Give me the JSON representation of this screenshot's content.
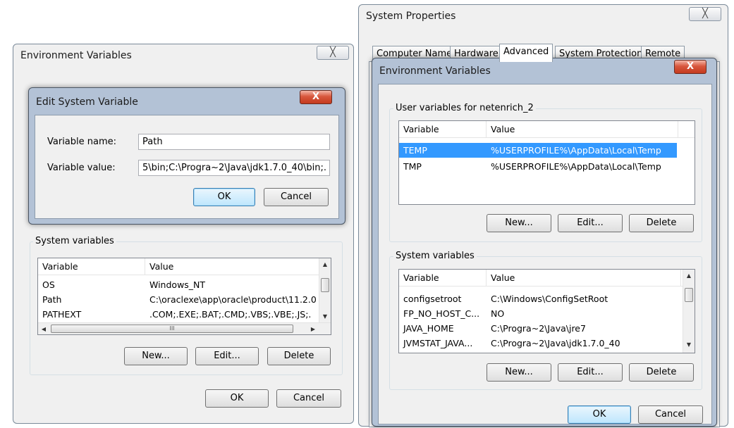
{
  "left_window": {
    "title": "Environment Variables",
    "close_label": "╳",
    "system_group_title": "System variables",
    "columns": [
      "Variable",
      "Value"
    ],
    "system_rows": [
      {
        "variable": "OS",
        "value": "Windows_NT"
      },
      {
        "variable": "Path",
        "value": "C:\\oraclexe\\app\\oracle\\product\\11.2.0"
      },
      {
        "variable": "PATHEXT",
        "value": ".COM;.EXE;.BAT;.CMD;.VBS;.VBE;.JS;."
      }
    ],
    "hscroll_grip": "III",
    "buttons": {
      "new": "New...",
      "edit": "Edit...",
      "delete": "Delete",
      "ok": "OK",
      "cancel": "Cancel"
    }
  },
  "edit_dialog": {
    "title": "Edit System Variable",
    "close_label": "X",
    "name_label": "Variable name:",
    "name_value": "Path",
    "value_label": "Variable value:",
    "value_value": "5\\bin;C:\\Progra~2\\Java\\jdk1.7.0_40\\bin;.",
    "ok": "OK",
    "cancel": "Cancel"
  },
  "system_properties": {
    "title": "System Properties",
    "close_label": "╳",
    "tabs": [
      {
        "label": "Computer Name",
        "active": false
      },
      {
        "label": "Hardware",
        "active": false
      },
      {
        "label": "Advanced",
        "active": true
      },
      {
        "label": "System Protection",
        "active": false
      },
      {
        "label": "Remote",
        "active": false
      }
    ]
  },
  "right_window": {
    "title": "Environment Variables",
    "close_label": "X",
    "user_group_title": "User variables for netenrich_2",
    "system_group_title": "System variables",
    "columns": [
      "Variable",
      "Value"
    ],
    "user_rows": [
      {
        "variable": "TEMP",
        "value": "%USERPROFILE%\\AppData\\Local\\Temp",
        "selected": true
      },
      {
        "variable": "TMP",
        "value": "%USERPROFILE%\\AppData\\Local\\Temp",
        "selected": false
      }
    ],
    "system_rows": [
      {
        "variable": "configsetroot",
        "value": "C:\\Windows\\ConfigSetRoot"
      },
      {
        "variable": "FP_NO_HOST_C...",
        "value": "NO"
      },
      {
        "variable": "JAVA_HOME",
        "value": "C:\\Progra~2\\Java\\jre7"
      },
      {
        "variable": "JVMSTAT_JAVA...",
        "value": "C:\\Progra~2\\Java\\jdk1.7.0_40"
      }
    ],
    "user_buttons": {
      "new": "New...",
      "edit": "Edit...",
      "delete": "Delete"
    },
    "system_buttons": {
      "new": "New...",
      "edit": "Edit...",
      "delete": "Delete"
    },
    "ok": "OK",
    "cancel": "Cancel"
  },
  "colors": {
    "selection": "#3399ff",
    "dialog_bg": "#f0f0f0",
    "close_red": "#c43a1e"
  }
}
